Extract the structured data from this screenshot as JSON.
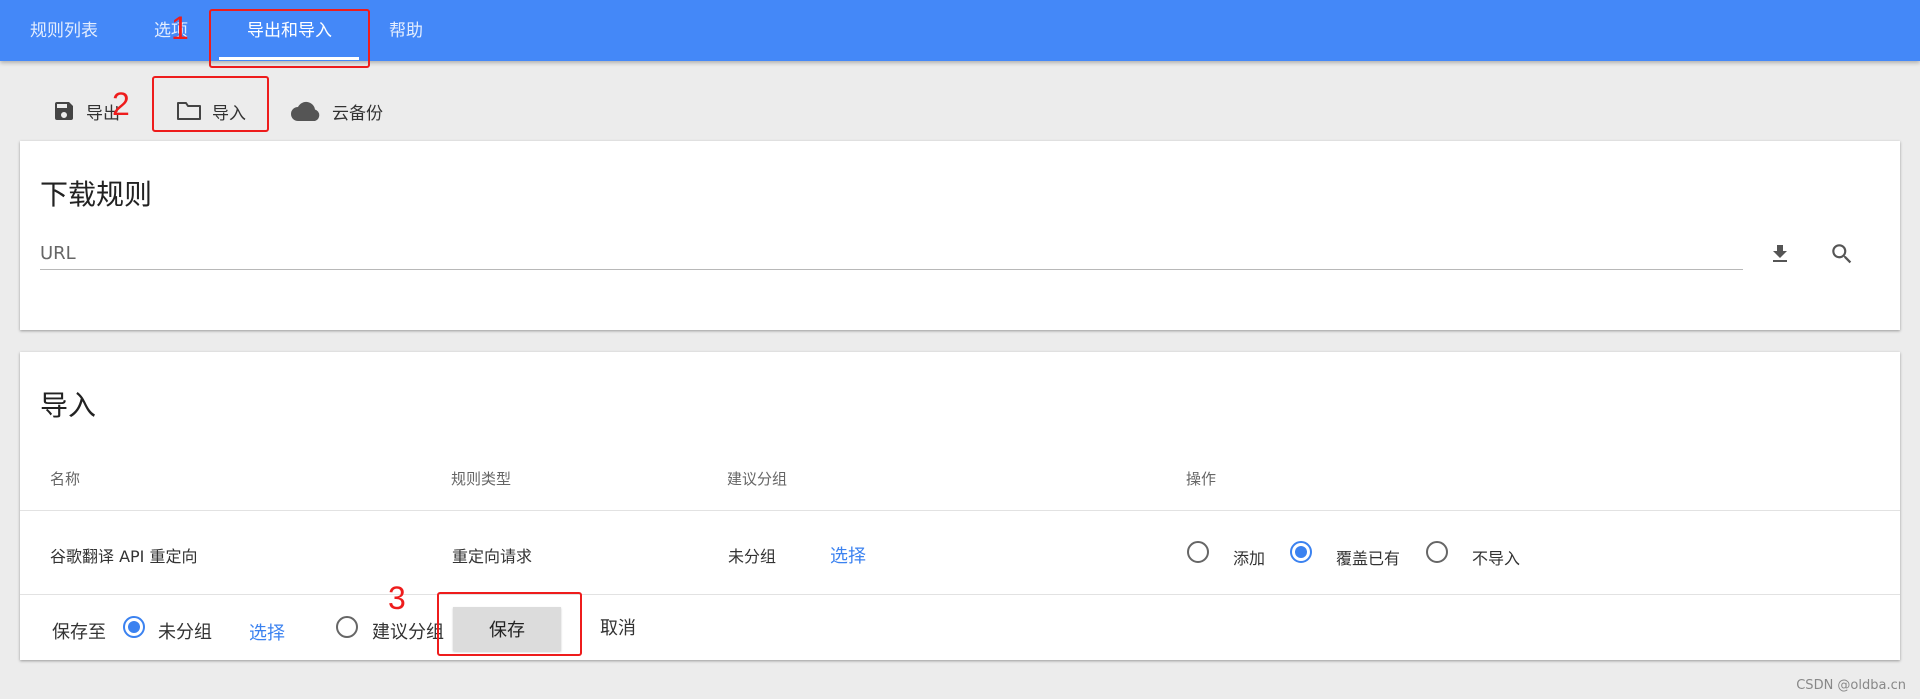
{
  "nav": {
    "tabs": [
      {
        "label": "规则列表",
        "active": false
      },
      {
        "label": "选项",
        "active": false
      },
      {
        "label": "导出和导入",
        "active": true
      },
      {
        "label": "帮助",
        "active": false
      }
    ]
  },
  "toolbar": {
    "export_label": "导出",
    "import_label": "导入",
    "cloud_backup_label": "云备份"
  },
  "download_card": {
    "title": "下载规则",
    "url_placeholder": "URL",
    "download_icon": "download-icon",
    "search_icon": "search-icon"
  },
  "import_card": {
    "title": "导入",
    "columns": [
      "名称",
      "规则类型",
      "建议分组",
      "操作"
    ],
    "rows": [
      {
        "name": "谷歌翻译 API 重定向",
        "type": "重定向请求",
        "group": "未分组",
        "select_label": "选择",
        "actions": [
          {
            "label": "添加",
            "checked": false
          },
          {
            "label": "覆盖已有",
            "checked": true
          },
          {
            "label": "不导入",
            "checked": false
          }
        ]
      }
    ],
    "footer": {
      "save_to_label": "保存至",
      "option_ungrouped": "未分组",
      "select_label": "选择",
      "option_suggested": "建议分组",
      "save_label": "保存",
      "cancel_label": "取消"
    }
  },
  "annotations": [
    "1",
    "2",
    "3"
  ],
  "watermark": "CSDN @oldba.cn",
  "colors": {
    "topbar": "#4488f8",
    "accent": "#3b82f0",
    "annotation": "#ee1c1c",
    "background": "#ececec"
  }
}
